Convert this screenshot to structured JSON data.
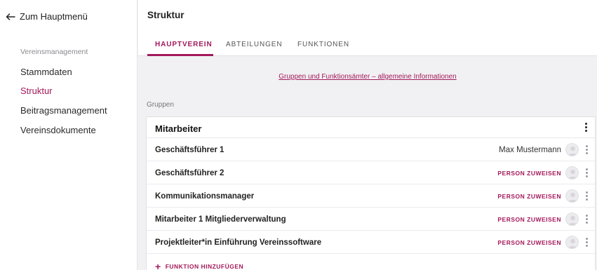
{
  "sidebar": {
    "back_label": "Zum Hauptmenü",
    "section_label": "Vereinsmanagement",
    "items": [
      {
        "label": "Stammdaten"
      },
      {
        "label": "Struktur"
      },
      {
        "label": "Beitragsmanagement"
      },
      {
        "label": "Vereinsdokumente"
      }
    ],
    "active_item": "Struktur"
  },
  "header": {
    "title": "Struktur",
    "tabs": [
      {
        "label": "HAUPTVEREIN"
      },
      {
        "label": "ABTEILUNGEN"
      },
      {
        "label": "FUNKTIONEN"
      }
    ],
    "active_tab": "HAUPTVEREIN"
  },
  "main": {
    "info_link": "Gruppen und Funktionsämter – allgemeine Informationen",
    "groups_label": "Gruppen",
    "group": {
      "title": "Mitarbeiter",
      "rows": [
        {
          "label": "Geschäftsführer 1",
          "person": "Max Mustermann"
        },
        {
          "label": "Geschäftsführer 2",
          "assign": "PERSON ZUWEISEN"
        },
        {
          "label": "Kommunikationsmanager",
          "assign": "PERSON ZUWEISEN"
        },
        {
          "label": "Mitarbeiter 1 Mitgliederverwaltung",
          "assign": "PERSON ZUWEISEN"
        },
        {
          "label": "Projektleiter*in Einführung Vereinssoftware",
          "assign": "PERSON ZUWEISEN"
        }
      ],
      "add_function_label": "FUNKTION HINZUFÜGEN"
    }
  },
  "colors": {
    "accent": "#a3195b",
    "background": "#f1f1f3"
  },
  "icons": {
    "back": "arrow-left-icon",
    "menu": "kebab-menu-icon",
    "avatar": "user-avatar-icon",
    "add": "plus-icon"
  }
}
